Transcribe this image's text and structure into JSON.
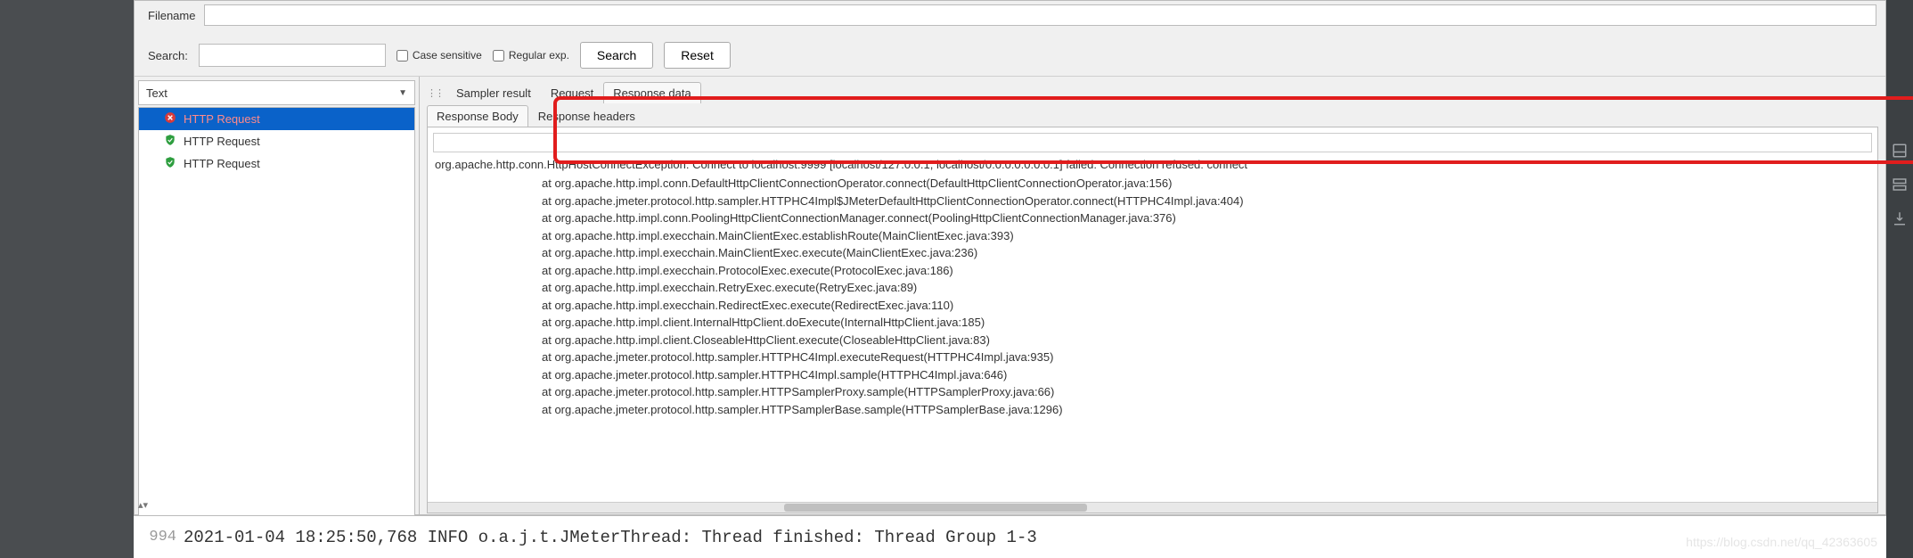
{
  "toolbar": {
    "filename_label": "Filename",
    "filename_value": "",
    "search_label": "Search:",
    "search_value": "",
    "case_sensitive_label": "Case sensitive",
    "regex_label": "Regular exp.",
    "search_btn": "Search",
    "reset_btn": "Reset"
  },
  "left": {
    "dropdown_value": "Text",
    "items": [
      {
        "label": "HTTP Request",
        "status": "error",
        "selected": true
      },
      {
        "label": "HTTP Request",
        "status": "ok",
        "selected": false
      },
      {
        "label": "HTTP Request",
        "status": "ok",
        "selected": false
      }
    ]
  },
  "tabs": {
    "main": [
      "Sampler result",
      "Request",
      "Response data"
    ],
    "main_active": 2,
    "sub": [
      "Response Body",
      "Response headers"
    ],
    "sub_active": 0
  },
  "response": {
    "find_value": "",
    "exception": "org.apache.http.conn.HttpHostConnectException: Connect to localhost:9999 [localhost/127.0.0.1, localhost/0:0:0:0:0:0:0:1] failed: Connection refused: connect",
    "stack": [
      "at org.apache.http.impl.conn.DefaultHttpClientConnectionOperator.connect(DefaultHttpClientConnectionOperator.java:156)",
      "at org.apache.jmeter.protocol.http.sampler.HTTPHC4Impl$JMeterDefaultHttpClientConnectionOperator.connect(HTTPHC4Impl.java:404)",
      "at org.apache.http.impl.conn.PoolingHttpClientConnectionManager.connect(PoolingHttpClientConnectionManager.java:376)",
      "at org.apache.http.impl.execchain.MainClientExec.establishRoute(MainClientExec.java:393)",
      "at org.apache.http.impl.execchain.MainClientExec.execute(MainClientExec.java:236)",
      "at org.apache.http.impl.execchain.ProtocolExec.execute(ProtocolExec.java:186)",
      "at org.apache.http.impl.execchain.RetryExec.execute(RetryExec.java:89)",
      "at org.apache.http.impl.execchain.RedirectExec.execute(RedirectExec.java:110)",
      "at org.apache.http.impl.client.InternalHttpClient.doExecute(InternalHttpClient.java:185)",
      "at org.apache.http.impl.client.CloseableHttpClient.execute(CloseableHttpClient.java:83)",
      "at org.apache.jmeter.protocol.http.sampler.HTTPHC4Impl.executeRequest(HTTPHC4Impl.java:935)",
      "at org.apache.jmeter.protocol.http.sampler.HTTPHC4Impl.sample(HTTPHC4Impl.java:646)",
      "at org.apache.jmeter.protocol.http.sampler.HTTPSamplerProxy.sample(HTTPSamplerProxy.java:66)",
      "at org.apache.jmeter.protocol.http.sampler.HTTPSamplerBase.sample(HTTPSamplerBase.java:1296)"
    ]
  },
  "console": {
    "line_no": "994",
    "text": "2021-01-04 18:25:50,768 INFO o.a.j.t.JMeterThread: Thread finished: Thread Group 1-3"
  },
  "watermark": "https://blog.csdn.net/qq_42363605"
}
